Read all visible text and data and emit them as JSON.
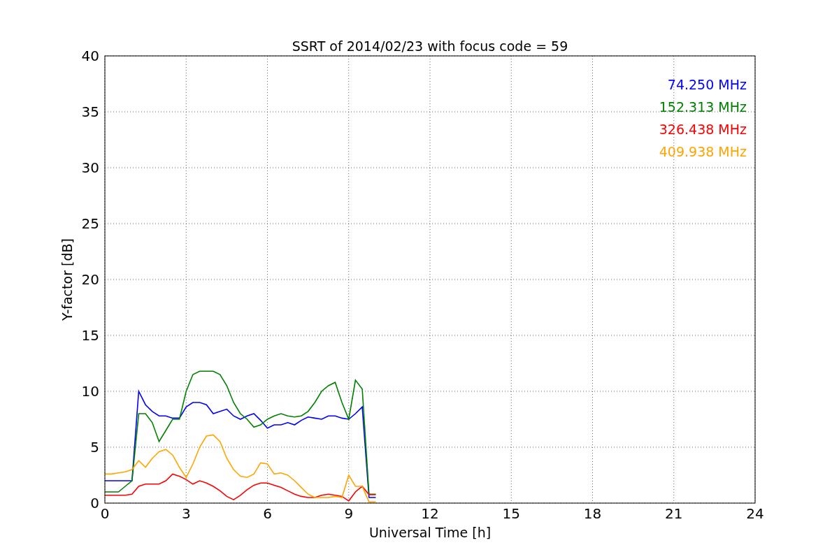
{
  "figure": {
    "chart_data": {
      "type": "line",
      "title": "SSRT of 2014/02/23 with focus code = 59",
      "xlabel": "Universal Time [h]",
      "ylabel": "Y-factor [dB]",
      "x": [
        0,
        0.25,
        0.5,
        0.75,
        1,
        1.25,
        1.5,
        1.75,
        2,
        2.25,
        2.5,
        2.75,
        3,
        3.25,
        3.5,
        3.75,
        4,
        4.25,
        4.5,
        4.75,
        5,
        5.25,
        5.5,
        5.75,
        6,
        6.25,
        6.5,
        6.75,
        7,
        7.25,
        7.5,
        7.75,
        8,
        8.25,
        8.5,
        8.75,
        9,
        9.25,
        9.5,
        9.75,
        10
      ],
      "series": [
        {
          "name": "74.250 MHz",
          "color": "#0000ff",
          "values": [
            2,
            2,
            2,
            2,
            2,
            10,
            8.8,
            8.2,
            7.8,
            7.8,
            7.6,
            7.6,
            8.6,
            9,
            9,
            8.8,
            8,
            8.2,
            8.4,
            7.8,
            7.5,
            7.8,
            8,
            7.4,
            6.7,
            7,
            7,
            7.2,
            7,
            7.4,
            7.7,
            7.6,
            7.5,
            7.8,
            7.8,
            7.6,
            7.5,
            8,
            8.6,
            0.5,
            0.5
          ]
        },
        {
          "name": "152.313 MHz",
          "color": "#008000",
          "values": [
            1,
            1,
            1,
            1.5,
            2,
            8,
            8,
            7.2,
            5.5,
            6.5,
            7.5,
            7.5,
            10,
            11.5,
            11.8,
            11.8,
            11.8,
            11.5,
            10.5,
            9,
            8,
            7.5,
            6.8,
            7,
            7.5,
            7.8,
            8,
            7.8,
            7.7,
            7.8,
            8.2,
            9,
            10,
            10.5,
            10.8,
            9,
            7.5,
            11,
            10.2,
            0.8,
            0.8
          ]
        },
        {
          "name": "326.438 MHz",
          "color": "#ff0000",
          "values": [
            0.7,
            0.7,
            0.7,
            0.7,
            0.8,
            1.5,
            1.7,
            1.7,
            1.7,
            2,
            2.6,
            2.4,
            2.1,
            1.7,
            2,
            1.8,
            1.5,
            1.1,
            0.6,
            0.3,
            0.7,
            1.2,
            1.6,
            1.8,
            1.8,
            1.6,
            1.4,
            1.1,
            0.8,
            0.6,
            0.5,
            0.5,
            0.7,
            0.8,
            0.7,
            0.6,
            0.2,
            1,
            1.5,
            0.75,
            0.75
          ]
        },
        {
          "name": "409.938 MHz",
          "color": "#ffa500",
          "values": [
            2.6,
            2.6,
            2.7,
            2.8,
            3,
            3.8,
            3.2,
            4,
            4.6,
            4.8,
            4.3,
            3.2,
            2.3,
            3.5,
            5,
            6,
            6.1,
            5.5,
            4,
            3,
            2.4,
            2.3,
            2.6,
            3.6,
            3.5,
            2.6,
            2.7,
            2.5,
            2,
            1.4,
            0.8,
            0.5,
            0.5,
            0.5,
            0.6,
            0.5,
            2.5,
            1.5,
            1.5,
            0.1,
            0.1
          ]
        }
      ],
      "grid": true,
      "xlim": [
        0,
        24
      ],
      "ylim": [
        0,
        40
      ],
      "xticks": [
        0,
        3,
        6,
        9,
        12,
        15,
        18,
        21,
        24
      ],
      "yticks": [
        0,
        5,
        10,
        15,
        20,
        25,
        30,
        35,
        40
      ]
    }
  }
}
